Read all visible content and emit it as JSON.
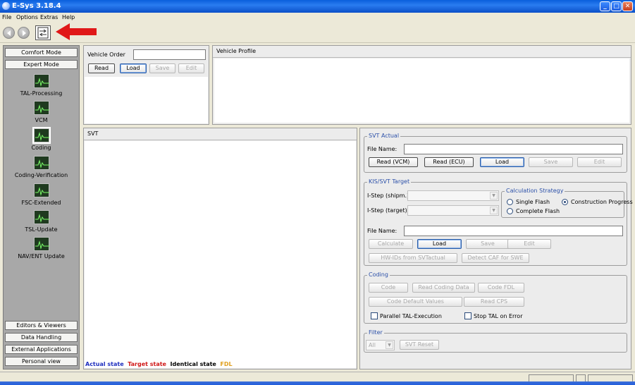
{
  "window": {
    "title": "E-Sys 3.18.4"
  },
  "menu": [
    "File",
    "Options",
    "Extras",
    "Help"
  ],
  "toolbar": {
    "back_icon": "back-arrow-icon",
    "forward_icon": "forward-arrow-icon",
    "switch_icon": "connection-switch-icon"
  },
  "sidebar": {
    "top_buttons": [
      "Comfort Mode",
      "Expert Mode"
    ],
    "items": [
      {
        "label": "TAL-Processing",
        "icon": "monitor-icon"
      },
      {
        "label": "VCM",
        "icon": "monitor-icon"
      },
      {
        "label": "Coding",
        "icon": "monitor-icon",
        "selected": true
      },
      {
        "label": "Coding-Verification",
        "icon": "monitor-icon"
      },
      {
        "label": "FSC-Extended",
        "icon": "monitor-icon"
      },
      {
        "label": "TSL-Update",
        "icon": "monitor-icon"
      },
      {
        "label": "NAV/ENT Update",
        "icon": "monitor-icon"
      }
    ],
    "bottom_buttons": [
      "Editors & Viewers",
      "Data Handling",
      "External Applications",
      "Personal view"
    ]
  },
  "vehicle_order": {
    "label": "Vehicle Order",
    "value": "",
    "buttons": [
      "Read",
      "Load",
      "Save",
      "Edit"
    ]
  },
  "vehicle_profile": {
    "label": "Vehicle Profile"
  },
  "svt": {
    "label": "SVT",
    "legend": [
      {
        "text": "Actual state",
        "color": "#1f2fbf"
      },
      {
        "text": "Target state",
        "color": "#d01818"
      },
      {
        "text": "Identical state",
        "color": "#000000"
      },
      {
        "text": "FDL",
        "color": "#e0a020"
      }
    ]
  },
  "svt_actual": {
    "title": "SVT Actual",
    "file_name_label": "File Name:",
    "file_name_value": "",
    "buttons": [
      "Read (VCM)",
      "Read (ECU)",
      "Load",
      "Save",
      "Edit"
    ]
  },
  "kis_target": {
    "title": "KIS/SVT Target",
    "istep_shipm_label": "I-Step (shipm.):",
    "istep_target_label": "I-Step (target):",
    "calc_strategy": {
      "title": "Calculation Strategy",
      "options": [
        "Single Flash",
        "Construction Progress",
        "Complete Flash"
      ],
      "selected": "Construction Progress"
    },
    "file_name_label": "File Name:",
    "file_name_value": "",
    "buttons_row1": [
      "Calculate",
      "Load",
      "Save",
      "Edit"
    ],
    "buttons_row2": [
      "HW-IDs from SVTactual",
      "Detect CAF for SWE"
    ]
  },
  "coding": {
    "title": "Coding",
    "buttons_row1": [
      "Code",
      "Read Coding Data",
      "Code FDL"
    ],
    "buttons_row2": [
      "Code Default Values",
      "Read CPS"
    ],
    "checkbox_parallel": "Parallel TAL-Execution",
    "checkbox_stop": "Stop TAL on Error"
  },
  "filter": {
    "title": "Filter",
    "select_value": "All",
    "reset_button": "SVT Reset"
  },
  "colors": {
    "titlebar": "#0a5fdc",
    "annotation_arrow": "#e01818"
  }
}
